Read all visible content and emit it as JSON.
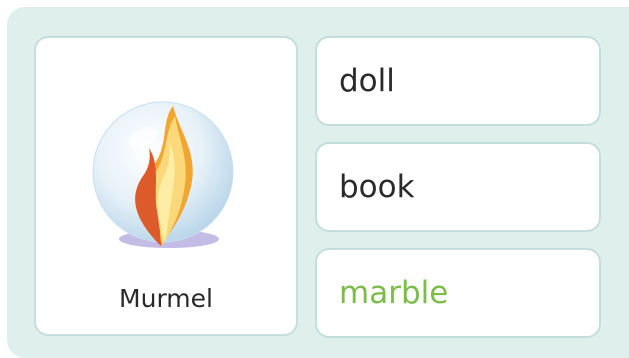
{
  "prompt_card": {
    "icon": "marble-icon",
    "word": "Murmel"
  },
  "options": [
    {
      "label": "doll",
      "state": "default"
    },
    {
      "label": "book",
      "state": "default"
    },
    {
      "label": "marble",
      "state": "correct"
    }
  ],
  "colors": {
    "panel_bg": "#dfefec",
    "card_border": "#c4dedb",
    "correct_text": "#7cbd4a",
    "text": "#2a2a2a"
  }
}
